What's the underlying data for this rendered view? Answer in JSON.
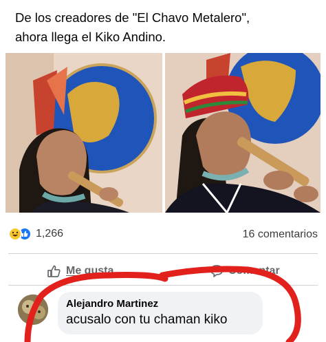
{
  "post": {
    "caption_line1": "De los creadores de \"El Chavo Metalero\",",
    "caption_line2": "ahora llega el Kiko Andino."
  },
  "reactions": {
    "icons": [
      "haha-reaction-icon",
      "like-reaction-icon"
    ],
    "count": "1,266"
  },
  "comments_count": "16 comentarios",
  "actions": {
    "like_label": "Me gusta",
    "comment_label": "Comentar"
  },
  "comment": {
    "author": "Alejandro Martinez",
    "text": "acusalo con tu chaman kiko"
  },
  "colors": {
    "scribble": "#e2211c",
    "like_blue": "#1877f2",
    "haha_yellow": "#f7c72f",
    "muted_text": "#65676b"
  }
}
